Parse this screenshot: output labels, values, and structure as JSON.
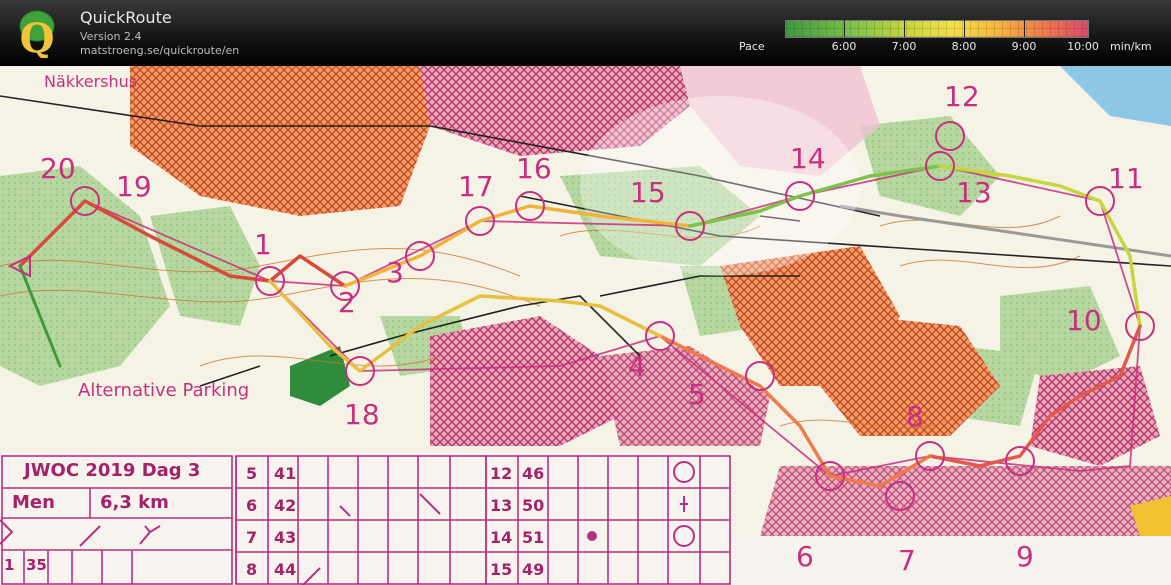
{
  "app": {
    "name": "QuickRoute",
    "version": "Version 2.4",
    "url": "matstroeng.se/quickroute/en"
  },
  "pace_legend": {
    "label": "Pace",
    "ticks": [
      "6:00",
      "7:00",
      "8:00",
      "9:00",
      "10:00"
    ],
    "unit": "min/km",
    "colors": [
      "#3f9a3f",
      "#7ec24a",
      "#c8d63e",
      "#f2e04a",
      "#f7b640",
      "#f07a4a",
      "#dc4a6a"
    ]
  },
  "map": {
    "place_labels": {
      "farm": "Näkkershus",
      "parking": "Alternative Parking"
    },
    "controls": [
      "20",
      "19",
      "1",
      "2",
      "3",
      "17",
      "16",
      "15",
      "14",
      "13",
      "12",
      "11",
      "10",
      "4",
      "5",
      "18",
      "8",
      "6",
      "7",
      "9"
    ],
    "sheet": {
      "title": "JWOC 2019 Dag 3",
      "class": "Men",
      "length": "6,3 km",
      "first_row": [
        "1",
        "35"
      ],
      "col2_rows": [
        [
          "5",
          "41"
        ],
        [
          "6",
          "42"
        ],
        [
          "7",
          "43"
        ],
        [
          "8",
          "44"
        ]
      ],
      "col3_rows": [
        [
          "12",
          "46"
        ],
        [
          "13",
          "50"
        ],
        [
          "14",
          "51"
        ],
        [
          "15",
          "49"
        ]
      ]
    }
  }
}
